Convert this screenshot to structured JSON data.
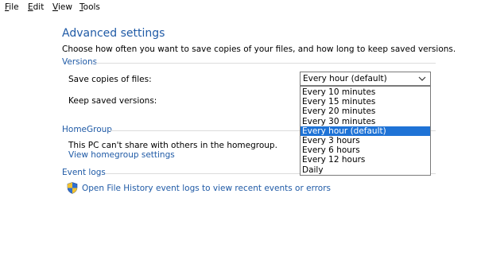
{
  "menubar": {
    "items": [
      {
        "accel": "F",
        "rest": "ile"
      },
      {
        "accel": "E",
        "rest": "dit"
      },
      {
        "accel": "V",
        "rest": "iew"
      },
      {
        "accel": "T",
        "rest": "ools"
      }
    ]
  },
  "page": {
    "title": "Advanced settings",
    "description": "Choose how often you want to save copies of your files, and how long to keep saved versions."
  },
  "versions": {
    "header": "Versions",
    "save_copies_label": "Save copies of files:",
    "save_copies_value": "Every hour (default)",
    "keep_versions_label": "Keep saved versions:",
    "options": [
      "Every 10 minutes",
      "Every 15 minutes",
      "Every 20 minutes",
      "Every 30 minutes",
      "Every hour (default)",
      "Every 3 hours",
      "Every 6 hours",
      "Every 12 hours",
      "Daily"
    ],
    "selected_option": "Every hour (default)"
  },
  "homegroup": {
    "header": "HomeGroup",
    "message": "This PC can't share with others in the homegroup.",
    "link": "View homegroup settings"
  },
  "event_logs": {
    "header": "Event logs",
    "link": "Open File History event logs to view recent events or errors",
    "icon": "uac-shield-icon"
  },
  "colors": {
    "accent": "#1f5aa6",
    "selection": "#1f73d6",
    "divider": "#dcdcdc"
  }
}
